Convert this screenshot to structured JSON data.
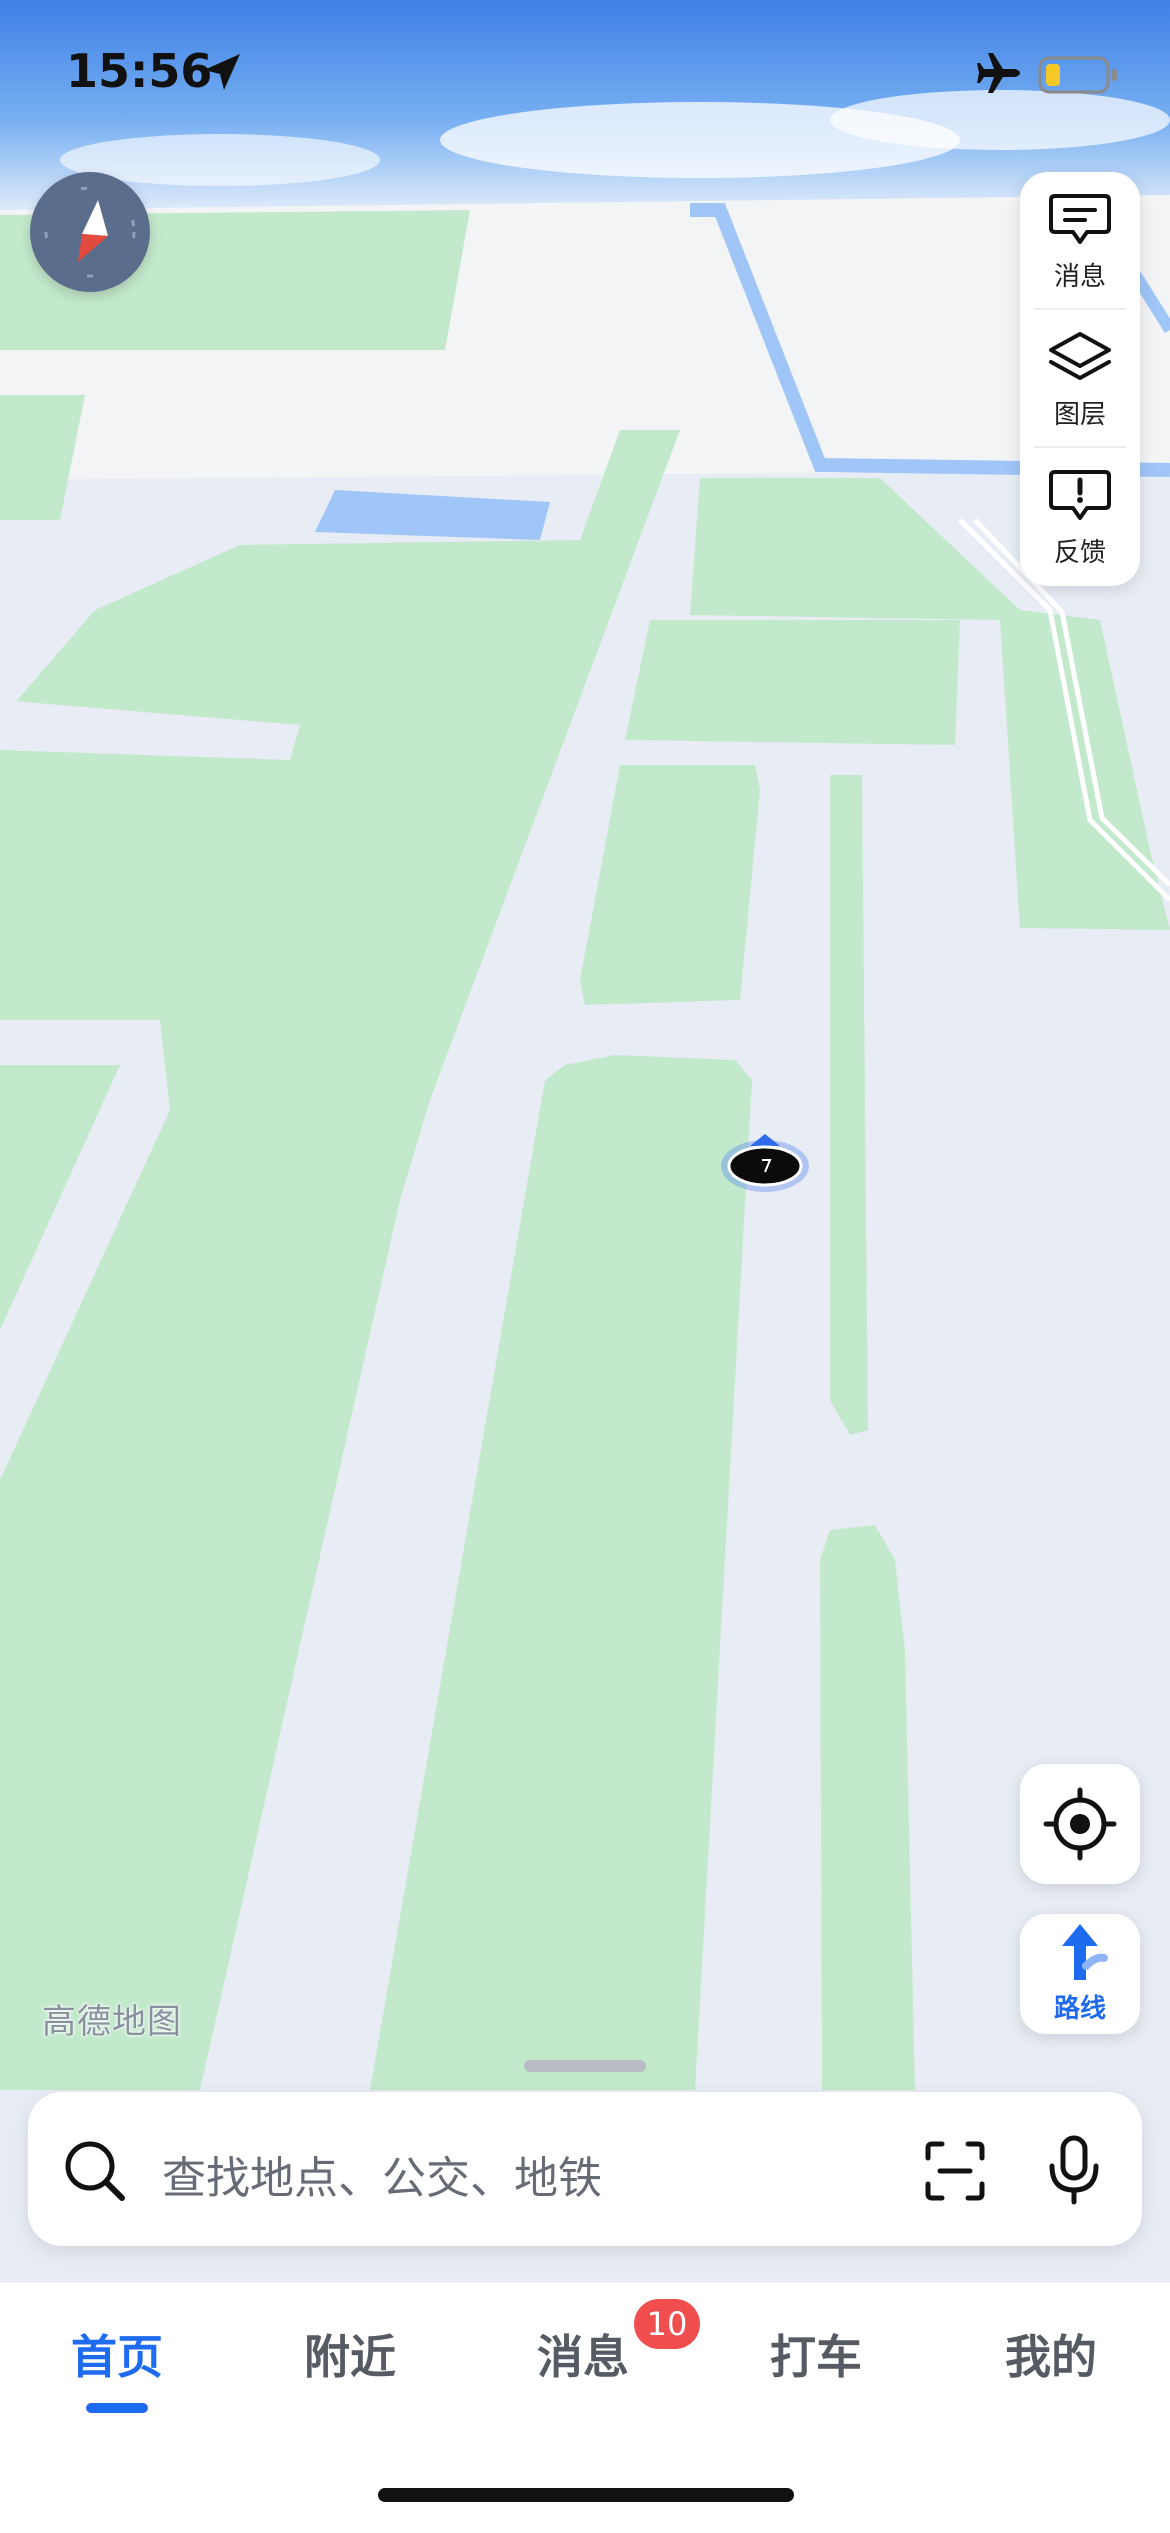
{
  "status_bar": {
    "time": "15:56"
  },
  "map": {
    "watermark": "高德地图"
  },
  "side_panel": {
    "items": [
      {
        "label": "消息",
        "icon": "message-icon"
      },
      {
        "label": "图层",
        "icon": "layers-icon"
      },
      {
        "label": "反馈",
        "icon": "feedback-icon"
      }
    ]
  },
  "route_button": {
    "label": "路线"
  },
  "search": {
    "placeholder": "查找地点、公交、地铁"
  },
  "tabs": [
    {
      "label": "首页",
      "active": true
    },
    {
      "label": "附近"
    },
    {
      "label": "消息",
      "badge": "10"
    },
    {
      "label": "打车"
    },
    {
      "label": "我的"
    }
  ],
  "colors": {
    "accent": "#1f6bf0",
    "badge": "#f04e4e",
    "green_area": "#c3e9cc",
    "road": "#e8ecf4",
    "water": "#9fc6f7"
  }
}
